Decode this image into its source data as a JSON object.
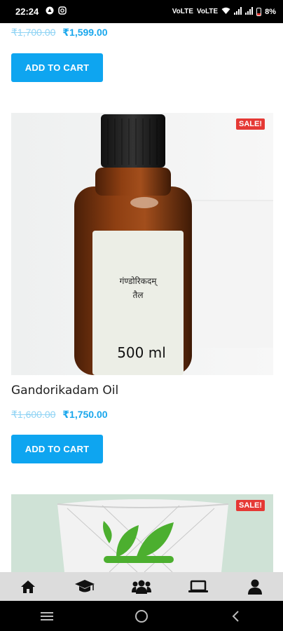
{
  "status_bar": {
    "time": "22:24",
    "battery": "8%",
    "network_labels": [
      "VoLTE",
      "VoLTE"
    ]
  },
  "products": [
    {
      "price_old": "₹1,700.00",
      "price_new": "₹1,599.00",
      "button_label": "ADD TO CART"
    },
    {
      "sale_label": "SALE!",
      "label_text_line1": "गंण्डोरिकदम्",
      "label_text_line2": "तैल",
      "label_volume": "500 ml",
      "title": "Gandorikadam Oil",
      "price_old": "₹1,600.00",
      "price_new": "₹1,750.00",
      "button_label": "ADD TO CART"
    },
    {
      "sale_label": "SALE!"
    }
  ],
  "bottom_nav": {
    "items": [
      "home-icon",
      "graduation-cap-icon",
      "users-icon",
      "laptop-icon",
      "user-icon"
    ]
  },
  "system_nav": {
    "items": [
      "recents-icon",
      "home-circle-icon",
      "back-icon"
    ]
  },
  "colors": {
    "accent": "#0ea5f0",
    "sale": "#e53935",
    "nav_bg": "#dcdcdc"
  }
}
